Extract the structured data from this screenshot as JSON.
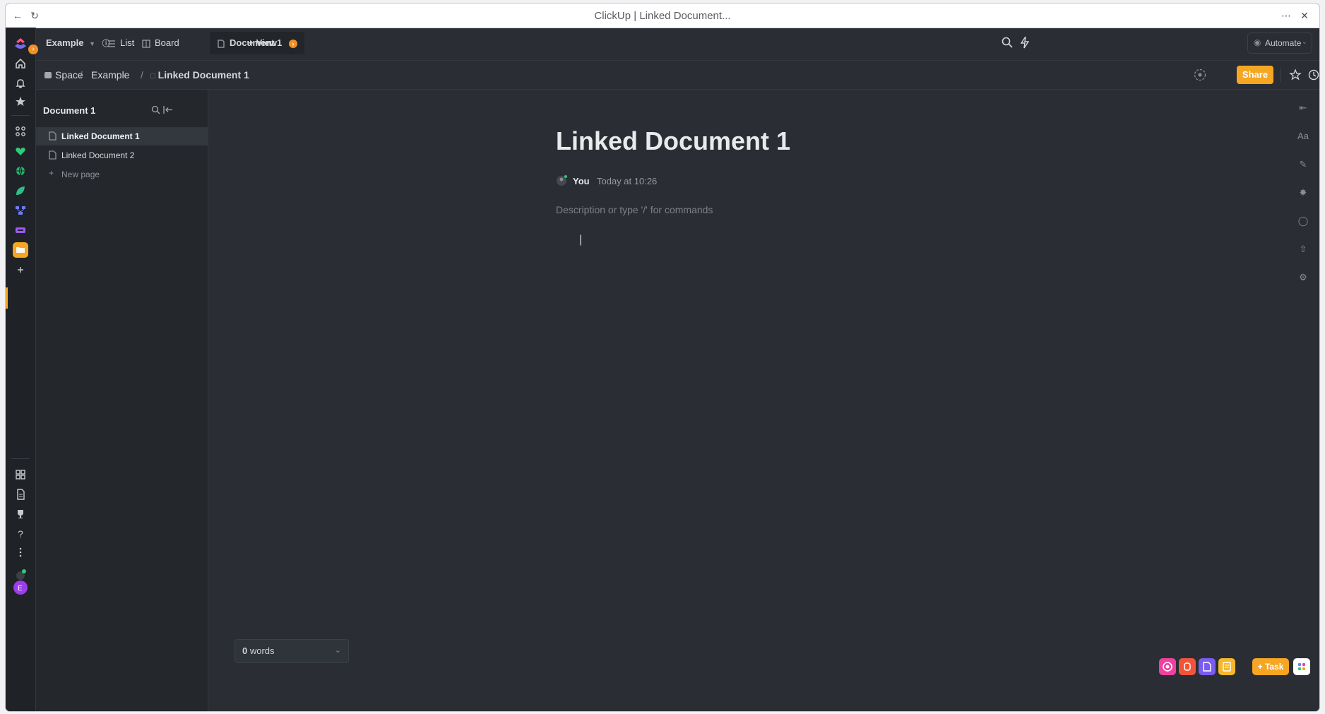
{
  "window": {
    "title": "ClickUp | Linked Document..."
  },
  "topbar": {
    "workspace": "Example",
    "views": [
      {
        "label": "List",
        "icon": "list-icon"
      },
      {
        "label": "Board",
        "icon": "board-icon"
      },
      {
        "label": "Document 1",
        "icon": "doc-icon",
        "active": true
      }
    ],
    "add_view_label": "View",
    "automate_label": "Automate"
  },
  "breadcrumb": {
    "items": [
      "Space",
      "Example",
      "Linked Document 1"
    ],
    "share_label": "Share"
  },
  "doc_sidebar": {
    "title": "Document 1",
    "pages": [
      {
        "label": "Linked Document 1",
        "active": true
      },
      {
        "label": "Linked Document 2",
        "active": false
      }
    ],
    "new_page_label": "New page"
  },
  "editor": {
    "title": "Linked Document 1",
    "author": "You",
    "timestamp": "Today at 10:26",
    "placeholder": "Description or type '/' for commands",
    "word_count": "0",
    "word_count_unit": "words"
  },
  "fabs": {
    "task_label": "Task"
  },
  "colors": {
    "accent": "#f5a623",
    "background": "#2a2e34",
    "rail": "#1f2226"
  }
}
